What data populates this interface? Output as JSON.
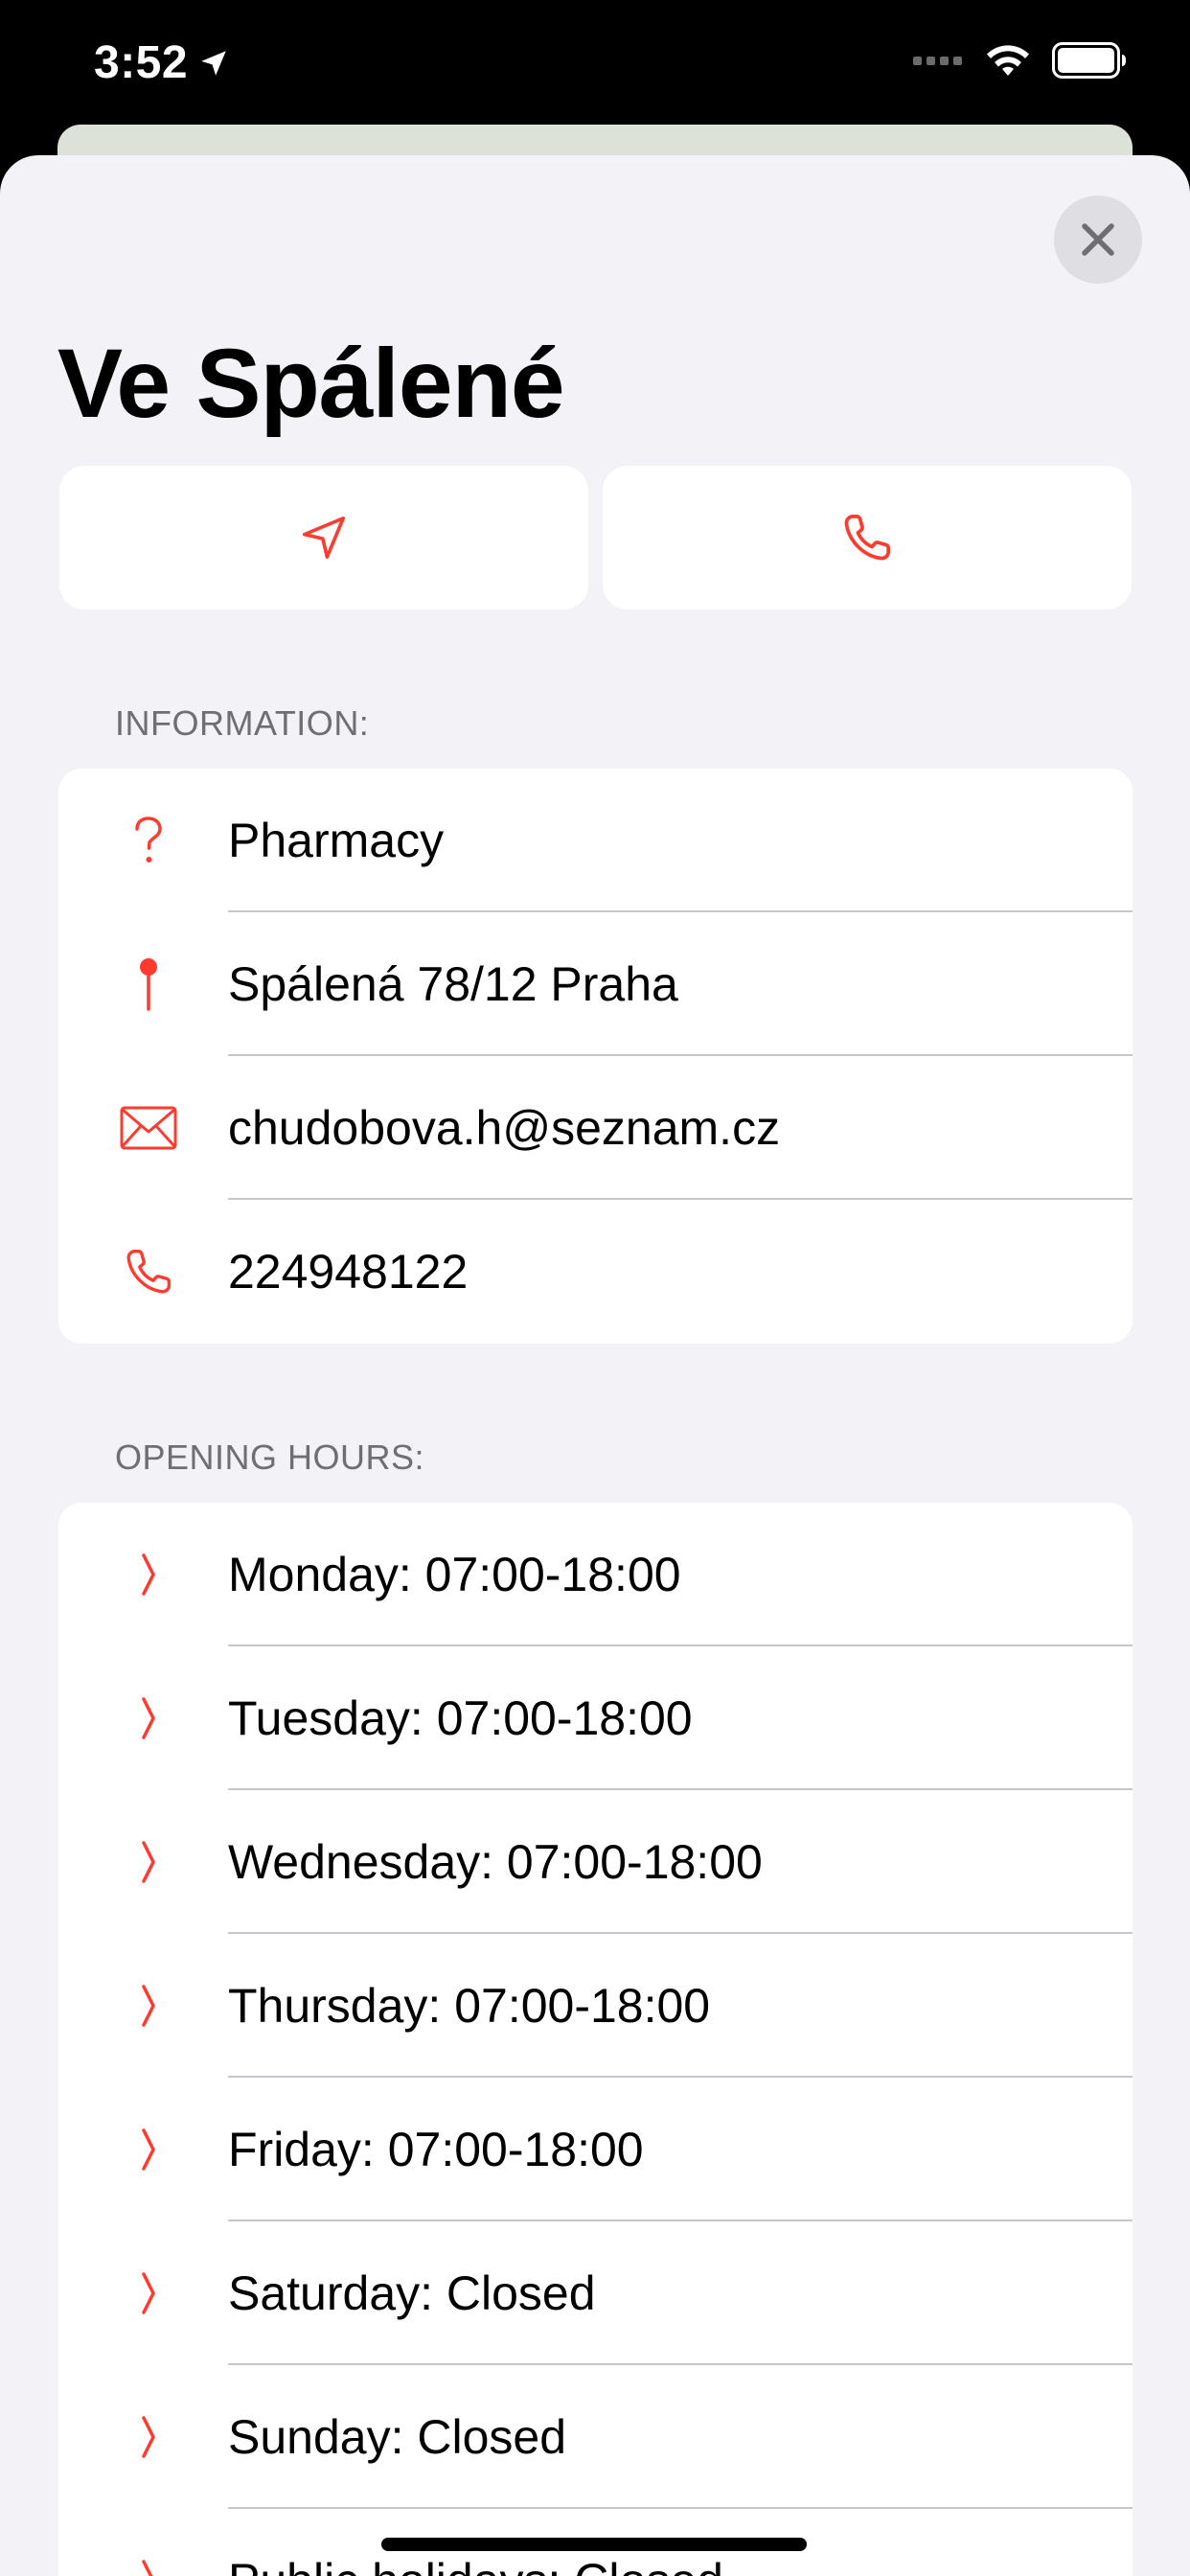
{
  "status_bar": {
    "time": "3:52"
  },
  "header": {
    "title": "Ve Spálené"
  },
  "actions": [
    {
      "icon": "navigation-arrow-icon"
    },
    {
      "icon": "phone-icon"
    }
  ],
  "information": {
    "header": "INFORMATION:",
    "items": [
      {
        "icon": "question-mark-icon",
        "label": "Pharmacy"
      },
      {
        "icon": "map-pin-icon",
        "label": "Spálená 78/12 Praha"
      },
      {
        "icon": "envelope-icon",
        "label": "chudobova.h@seznam.cz"
      },
      {
        "icon": "phone-icon",
        "label": "224948122"
      }
    ]
  },
  "opening_hours": {
    "header": "OPENING HOURS:",
    "items": [
      {
        "icon": "angle-bracket-icon",
        "label": "Monday: 07:00-18:00"
      },
      {
        "icon": "angle-bracket-icon",
        "label": "Tuesday: 07:00-18:00"
      },
      {
        "icon": "angle-bracket-icon",
        "label": "Wednesday: 07:00-18:00"
      },
      {
        "icon": "angle-bracket-icon",
        "label": "Thursday: 07:00-18:00"
      },
      {
        "icon": "angle-bracket-icon",
        "label": "Friday: 07:00-18:00"
      },
      {
        "icon": "angle-bracket-icon",
        "label": "Saturday: Closed"
      },
      {
        "icon": "angle-bracket-icon",
        "label": "Sunday: Closed"
      },
      {
        "icon": "angle-bracket-icon",
        "label": "Public holidays: Closed"
      }
    ]
  },
  "colors": {
    "accent": "#ff3b30",
    "background": "#f2f2f7",
    "card": "#ffffff",
    "secondary_text": "#6e6e73"
  }
}
